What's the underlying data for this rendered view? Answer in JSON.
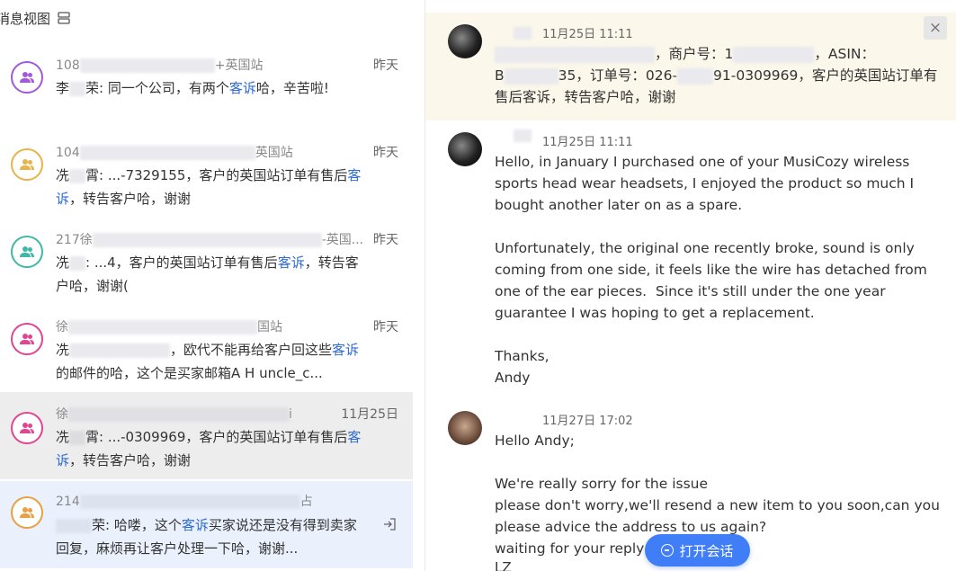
{
  "left": {
    "header_title": "消息视图",
    "conversations": [
      {
        "title_prefix": "108",
        "title_suffix": "+英国站",
        "time": "昨天",
        "avatar_color": "#a259d9",
        "msg_sender_prefix": "李",
        "msg_sender_suffix": "荣: 同一个公司，有两个",
        "msg_link": "客诉",
        "msg_after": "哈，辛苦啦!"
      },
      {
        "title_prefix": "104",
        "title_suffix": "英国站",
        "time": "昨天",
        "avatar_color": "#e8b34a",
        "msg_sender_prefix": "冼",
        "msg_sender_suffix": "霄: ...-7329155，客户的英国站订单有售后",
        "msg_link": "客诉",
        "msg_after": "，转告客户哈，谢谢"
      },
      {
        "title_prefix": "217徐",
        "title_suffix": "-英国...",
        "time": "昨天",
        "avatar_color": "#3fb8a8",
        "msg_sender_prefix": "冼",
        "msg_sender_suffix": ": ...4，客户的英国站订单有售后",
        "msg_link": "客诉",
        "msg_after": "，转告客户哈，谢谢("
      },
      {
        "title_prefix": "徐",
        "title_suffix": "国站",
        "time": "昨天",
        "avatar_color": "#e04592",
        "msg_sender_prefix": "冼",
        "msg_sender_suffix": "，欧代不能再给客户回这些",
        "msg_link": "客诉",
        "msg_after": "的邮件的哈，这个是买家邮箱A H uncle_c..."
      },
      {
        "title_prefix": "徐",
        "title_suffix": "i",
        "time": "11月25日",
        "avatar_color": "#e04592",
        "msg_sender_prefix": "冼",
        "msg_sender_suffix": "霄: ...-0309969，客户的英国站订单有售后",
        "msg_link": "客诉",
        "msg_after": "，转告客户哈，谢谢"
      },
      {
        "title_prefix": "214",
        "title_suffix": "占",
        "time": "",
        "avatar_color": "#e8a042",
        "msg_sender_prefix": "",
        "msg_sender_suffix": "荣: 哈喽，这个",
        "msg_link": "客诉",
        "msg_after": "买家说还是没有得到卖家回复，麻烦再让客户处理一下哈，谢谢..."
      }
    ]
  },
  "right": {
    "close_label": "×",
    "messages": [
      {
        "time": "11月25日 11:11",
        "body_parts": [
          "，商户号：1",
          "，ASIN：",
          "B",
          "35，订单号：026-",
          "91-0309969，客户的英国站订单有售后客诉，转告客户哈，谢谢"
        ]
      },
      {
        "time": "11月25日 11:11",
        "body": "Hello, in January I purchased one of your MusiCozy wireless sports head wear headsets, I enjoyed the product so much I bought another later on as a spare.\n\nUnfortunately, the original one recently broke, sound is only coming from one side, it feels like the wire has detached from one of the ear pieces.  Since it's still under the one year guarantee I was hoping to get a replacement.\n\nThanks,\nAndy"
      },
      {
        "time": "11月27日 17:02",
        "body": "Hello Andy;\n\nWe're really sorry for the issue\nplease don't worry,we'll resend a new item to you soon,can you please advice the address to us again?\nwaiting for your reply",
        "trailing": "LZ"
      }
    ],
    "open_button_label": "打开会话"
  },
  "colors": {
    "link": "#2e6bd6",
    "accent": "#3f7ef7",
    "top_box_bg": "#fbf7ea",
    "selected_grey": "#ededed",
    "selected_blue": "#eaf1fd"
  }
}
